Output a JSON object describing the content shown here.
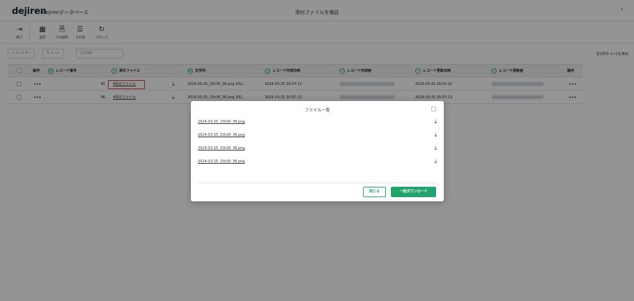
{
  "header": {
    "logo": "dejiren",
    "app_title": "dejirenデータベース",
    "page_title": "添付ファイルを検証",
    "collapse_icon": "chevron-up-double-icon"
  },
  "toolbar": {
    "buttons": [
      {
        "label": "終了",
        "icon": "exit-icon"
      },
      {
        "label": "固定",
        "icon": "grid-icon"
      },
      {
        "label": "CSV操作",
        "icon": "file-icon"
      },
      {
        "label": "その他",
        "icon": "menu-icon"
      },
      {
        "label": "リロード",
        "icon": "reload-icon"
      }
    ]
  },
  "filter": {
    "filter_label": "フィルター",
    "sort_label": "ソート",
    "search_placeholder": "全文検索",
    "count_text": "全2件中 1〜2を表示"
  },
  "table": {
    "columns": [
      {
        "label": "操作",
        "icon": ""
      },
      {
        "label": "レコード番号",
        "icon": "123"
      },
      {
        "label": "添付ファイル",
        "icon": "clip"
      },
      {
        "label": "文字列",
        "icon": "Ab"
      },
      {
        "label": "レコード作成日時",
        "icon": "clock"
      },
      {
        "label": "レコード作成者",
        "icon": "user"
      },
      {
        "label": "レコード更新日時",
        "icon": "clock"
      },
      {
        "label": "レコード更新者",
        "icon": "user"
      },
      {
        "label": "操作",
        "icon": ""
      }
    ],
    "rows": [
      {
        "record_no": "45",
        "attachment": "4件のファイル",
        "text": "2024-03-25_15h30_36.png 202…",
        "created": "2024-03-25 16:07:12",
        "updated": "2024-03-25 16:07:12"
      },
      {
        "record_no": "46",
        "attachment": "4件のファイル",
        "text": "2024-03-25_15h30_36.png 202…",
        "created": "2024-03-25 16:07:13",
        "updated": "2024-03-25 16:07:13"
      }
    ]
  },
  "modal": {
    "title": "ファイル一覧",
    "files": [
      "2024-03-25_15h30_36.png",
      "2024-03-25_15h30_36.png",
      "2024-03-25_15h30_36.png",
      "2024-03-25_15h30_36.png"
    ],
    "close_label": "閉じる",
    "download_all_label": "一括ダウンロード"
  },
  "colors": {
    "accent": "#23a36d",
    "highlight": "#e03a3a"
  }
}
